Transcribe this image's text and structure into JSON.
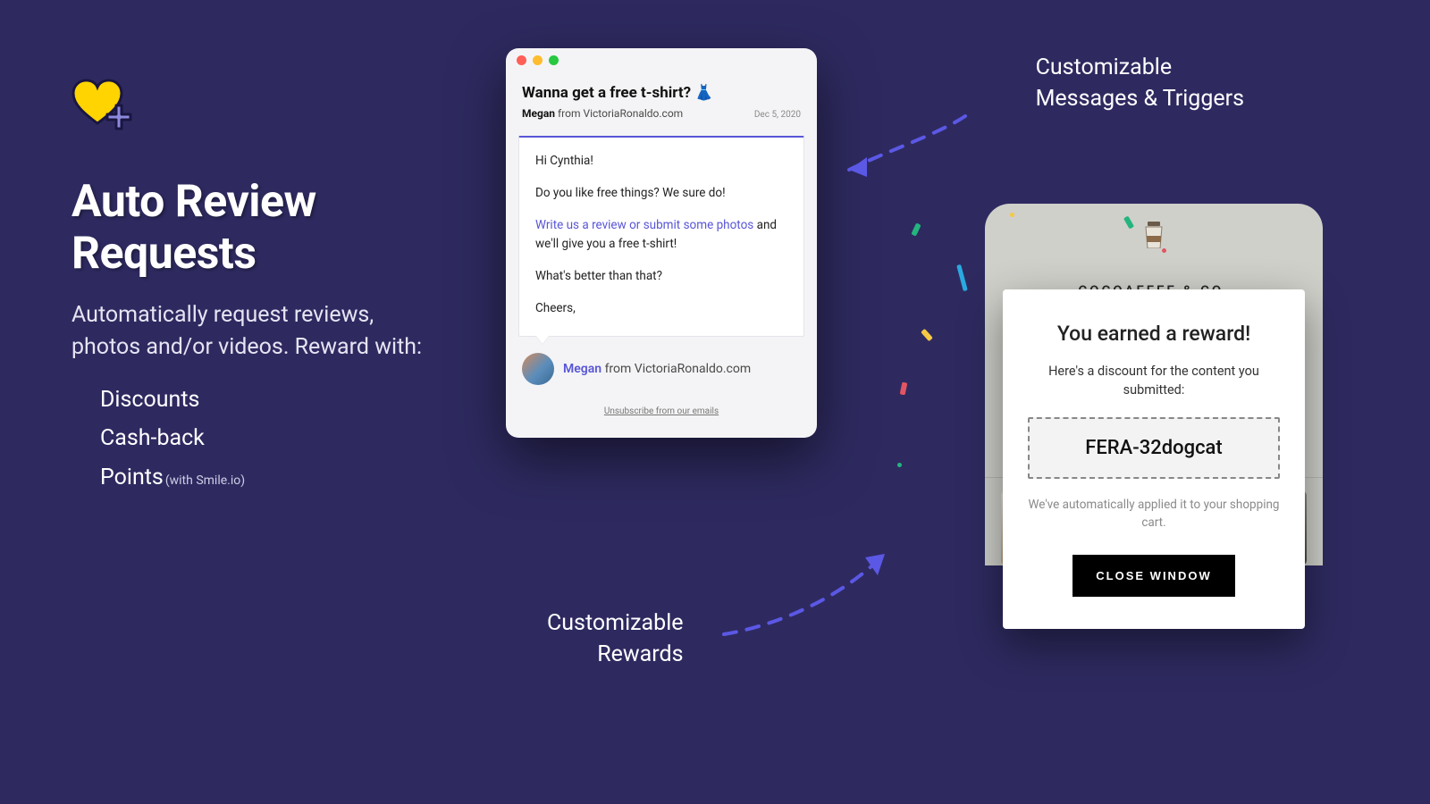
{
  "left": {
    "title_line1": "Auto Review",
    "title_line2": "Requests",
    "subtitle": "Automatically request reviews, photos and/or videos. Reward with:",
    "bullets": {
      "0": "Discounts",
      "1": "Cash-back",
      "2": "Points",
      "2_note": "(with Smile.io)"
    }
  },
  "email": {
    "subject": "Wanna get a free t-shirt? 👗",
    "sender_name": "Megan",
    "sender_from_word": " from ",
    "sender_domain": "VictoriaRonaldo.com",
    "date": "Dec 5, 2020",
    "body": {
      "greeting": "Hi Cynthia!",
      "line2": "Do you like free things? We sure do!",
      "cta_link": "Write us a review or submit some photos",
      "cta_rest": " and we'll give you a free t-shirt!",
      "line4": "What's better than that?",
      "signoff": "Cheers,"
    },
    "unsubscribe": "Unsubscribe from our emails"
  },
  "phone": {
    "brand": "COCOAFFEE & CO."
  },
  "reward": {
    "title": "You earned a reward!",
    "subtitle": "Here's a discount for the content you submitted:",
    "code": "FERA-32dogcat",
    "note": "We've automatically applied it to your shopping cart.",
    "button": "CLOSE WINDOW"
  },
  "callouts": {
    "top_line1": "Customizable",
    "top_line2": "Messages & Triggers",
    "bottom_line1": "Customizable",
    "bottom_line2": "Rewards"
  }
}
